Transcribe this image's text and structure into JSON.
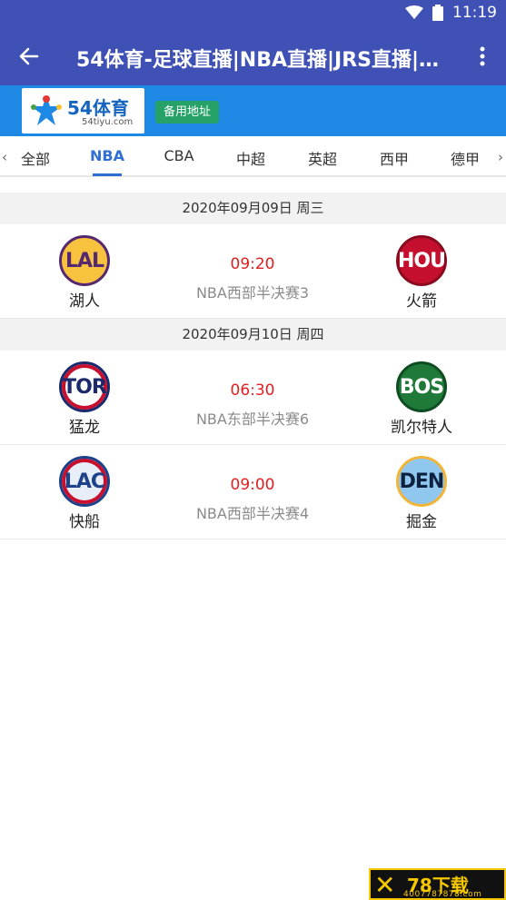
{
  "status_bar": {
    "time": "11:19"
  },
  "app_bar": {
    "title": "54体育-足球直播|NBA直播|JRS直播|低..."
  },
  "banner": {
    "logo_text": "54体育",
    "logo_sub": "54tiyu.com",
    "backup_label": "备用地址"
  },
  "tabs": [
    {
      "label": "全部"
    },
    {
      "label": "NBA",
      "active": true
    },
    {
      "label": "CBA"
    },
    {
      "label": "中超"
    },
    {
      "label": "英超"
    },
    {
      "label": "西甲"
    },
    {
      "label": "德甲"
    }
  ],
  "days": [
    {
      "date": "2020年09月09日 周三",
      "matches": [
        {
          "home": {
            "abbr": "LAL",
            "name": "湖人"
          },
          "time": "09:20",
          "league": "NBA西部半决赛3",
          "away": {
            "abbr": "HOU",
            "name": "火箭"
          }
        }
      ]
    },
    {
      "date": "2020年09月10日 周四",
      "matches": [
        {
          "home": {
            "abbr": "TOR",
            "name": "猛龙"
          },
          "time": "06:30",
          "league": "NBA东部半决赛6",
          "away": {
            "abbr": "BOS",
            "name": "凯尔特人"
          }
        },
        {
          "home": {
            "abbr": "LAC",
            "name": "快船"
          },
          "time": "09:00",
          "league": "NBA西部半决赛4",
          "away": {
            "abbr": "DEN",
            "name": "掘金"
          }
        }
      ]
    }
  ],
  "watermark": {
    "main": "78下载",
    "sub": "4007787878.com"
  },
  "colors": {
    "primary": "#3f51b5",
    "banner": "#1e88e5",
    "accent_tab": "#2e6fd1",
    "time_red": "#e02020",
    "backup_green": "#26a269"
  }
}
